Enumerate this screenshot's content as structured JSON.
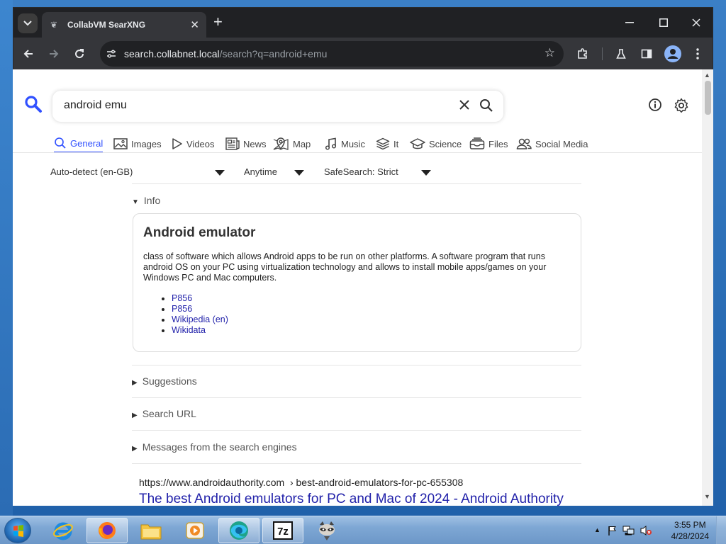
{
  "browser": {
    "tab_title": "CollabVM SearXNG",
    "url_host": "search.collabnet.local",
    "url_path": "/search?q=android+emu"
  },
  "search": {
    "query": "android emu"
  },
  "categories": [
    {
      "label": "General",
      "active": true
    },
    {
      "label": "Images"
    },
    {
      "label": "Videos"
    },
    {
      "label": "News"
    },
    {
      "label": "Map"
    },
    {
      "label": "Music"
    },
    {
      "label": "It"
    },
    {
      "label": "Science"
    },
    {
      "label": "Files"
    },
    {
      "label": "Social Media"
    }
  ],
  "filters": {
    "language": "Auto-detect (en-GB)",
    "time": "Anytime",
    "safesearch": "SafeSearch: Strict"
  },
  "info": {
    "toggle_label": "Info",
    "title": "Android emulator",
    "description": "class of software which allows Android apps to be run on other platforms. A software program that runs android OS on your PC using virtualization technology and allows to install mobile apps/games on your Windows PC and Mac computers.",
    "links": [
      "P856",
      "P856",
      "Wikipedia (en)",
      "Wikidata"
    ]
  },
  "sections": {
    "suggestions": "Suggestions",
    "search_url": "Search URL",
    "messages": "Messages from the search engines"
  },
  "result": {
    "url_domain": "https://www.androidauthority.com",
    "url_path": "› best-android-emulators-for-pc-655308",
    "title": "The best Android emulators for PC and Mac of 2024 - Android Authority"
  },
  "taskbar": {
    "time": "3:55 PM",
    "date": "4/28/2024"
  },
  "colors": {
    "accent": "#3050ff",
    "link": "#2222aa"
  }
}
